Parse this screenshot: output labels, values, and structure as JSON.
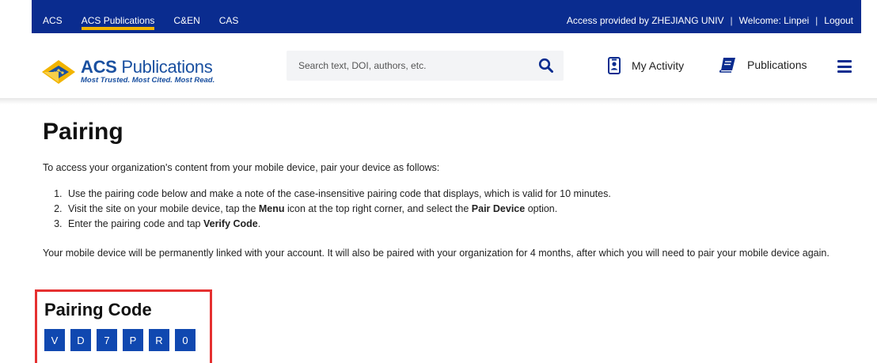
{
  "topbar": {
    "links": [
      "ACS",
      "ACS Publications",
      "C&EN",
      "CAS"
    ],
    "active_link": "ACS Publications",
    "access_text": "Access provided by ZHEJIANG UNIV",
    "welcome_text": "Welcome: Linpei",
    "logout_label": "Logout",
    "bar_color": "#0a2c8f",
    "active_underline_color": "#f2b400"
  },
  "header": {
    "logo_title_bold": "ACS",
    "logo_title_rest": " Publications",
    "logo_tagline": "Most Trusted. Most Cited. Most Read.",
    "search": {
      "placeholder": "Search text, DOI, authors, etc.",
      "value": "",
      "icon": "search-icon"
    },
    "my_activity_label": "My Activity",
    "publications_label": "Publications",
    "menu_icon": "hamburger-menu-icon"
  },
  "page": {
    "title": "Pairing",
    "intro": "To access your organization's content from your mobile device, pair your device as follows:",
    "steps": [
      {
        "parts": [
          {
            "text": "Use the pairing code below and make a note of the case-insensitive pairing code that displays, which is valid for 10 minutes.",
            "bold": false
          }
        ]
      },
      {
        "parts": [
          {
            "text": "Visit the site on your mobile device, tap the ",
            "bold": false
          },
          {
            "text": "Menu",
            "bold": true
          },
          {
            "text": " icon at the top right corner, and select the ",
            "bold": false
          },
          {
            "text": "Pair Device",
            "bold": true
          },
          {
            "text": " option.",
            "bold": false
          }
        ]
      },
      {
        "parts": [
          {
            "text": "Enter the pairing code and tap ",
            "bold": false
          },
          {
            "text": "Verify Code",
            "bold": true
          },
          {
            "text": ".",
            "bold": false
          }
        ]
      }
    ],
    "note": "Your mobile device will be permanently linked with your account. It will also be paired with your organization for 4 months, after which you will need to pair your mobile device again.",
    "code_title": "Pairing Code",
    "code_chars": [
      "V",
      "D",
      "7",
      "P",
      "R",
      "0"
    ],
    "highlight_color": "#e53030",
    "code_box_color": "#1048b0"
  }
}
